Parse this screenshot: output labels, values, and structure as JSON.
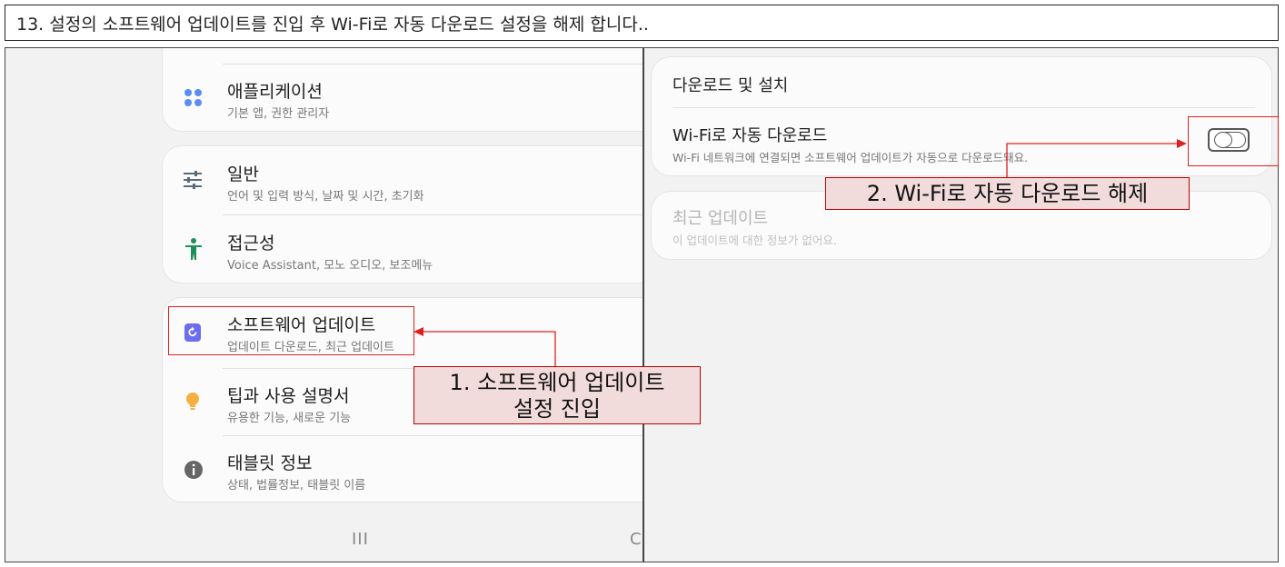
{
  "header": {
    "text": "13. 설정의 소프트웨어 업데이트를 진입 후 Wi-Fi로 자동 다운로드 설정을 해제 합니다.."
  },
  "left": {
    "items": [
      {
        "title": "애플리케이션",
        "subtitle": "기본 앱, 권한 관리자",
        "icon": "apps-grid-icon"
      },
      {
        "title": "일반",
        "subtitle": "언어 및 입력 방식, 날짜 및 시간, 초기화",
        "icon": "sliders-icon"
      },
      {
        "title": "접근성",
        "subtitle": "Voice Assistant, 모노 오디오, 보조메뉴",
        "icon": "accessibility-icon"
      },
      {
        "title": "소프트웨어 업데이트",
        "subtitle": "업데이트 다운로드, 최근 업데이트",
        "icon": "software-update-icon"
      },
      {
        "title": "팁과 사용 설명서",
        "subtitle": "유용한 기능, 새로운 기능",
        "icon": "lightbulb-icon"
      },
      {
        "title": "태블릿 정보",
        "subtitle": "상태, 법률정보, 태블릿 이름",
        "icon": "info-icon"
      }
    ],
    "nav": {
      "recent": "III",
      "home": "C"
    }
  },
  "right": {
    "download_section_title": "다운로드 및 설치",
    "wifi_auto_title": "Wi-Fi로 자동 다운로드",
    "wifi_auto_desc": "Wi-Fi 네트워크에 연결되면 소프트웨어 업데이트가 자동으로 다운로드돼요.",
    "wifi_auto_enabled": false,
    "recent_title": "최근 업데이트",
    "recent_desc": "이 업데이트에 대한 정보가 없어요."
  },
  "annotations": {
    "step1_line1": "1. 소프트웨어 업데이트",
    "step1_line2": "설정 진입",
    "step2": "2. Wi-Fi로 자동 다운로드 해제"
  },
  "colors": {
    "annot_bg": "#f2dcdb",
    "annot_border": "#c00000",
    "highlight": "#e02020",
    "accent_blue": "#5b8def",
    "update_icon": "#6c6cf0",
    "bulb": "#f5b041"
  }
}
